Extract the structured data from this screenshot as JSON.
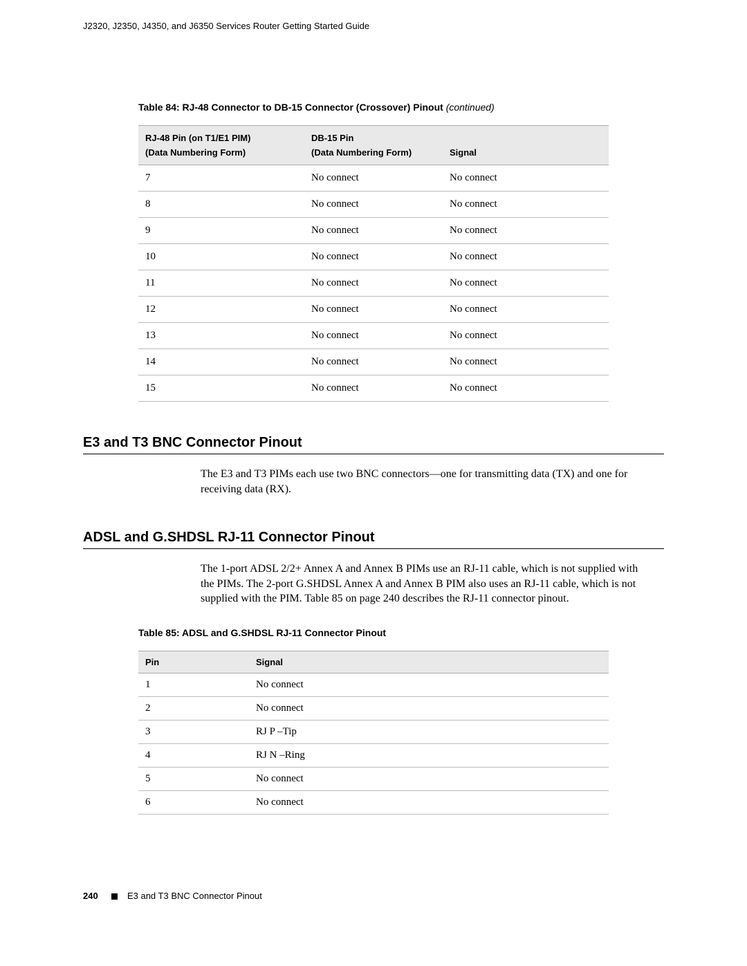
{
  "header": {
    "title": "J2320, J2350, J4350, and J6350 Services Router Getting Started Guide"
  },
  "table84": {
    "caption_main": "Table 84: RJ-48 Connector to DB-15 Connector (Crossover) Pinout",
    "caption_cont": " (continued)",
    "col1_line1": "RJ-48 Pin (on T1/E1 PIM)",
    "col1_line2": "(Data Numbering Form)",
    "col2_line1": "DB-15 Pin",
    "col2_line2": "(Data Numbering Form)",
    "col3": "Signal",
    "rows": [
      {
        "pin": "7",
        "db15": "No connect",
        "signal": "No connect"
      },
      {
        "pin": "8",
        "db15": "No connect",
        "signal": "No connect"
      },
      {
        "pin": "9",
        "db15": "No connect",
        "signal": "No connect"
      },
      {
        "pin": "10",
        "db15": "No connect",
        "signal": "No connect"
      },
      {
        "pin": "11",
        "db15": "No connect",
        "signal": "No connect"
      },
      {
        "pin": "12",
        "db15": "No connect",
        "signal": "No connect"
      },
      {
        "pin": "13",
        "db15": "No connect",
        "signal": "No connect"
      },
      {
        "pin": "14",
        "db15": "No connect",
        "signal": "No connect"
      },
      {
        "pin": "15",
        "db15": "No connect",
        "signal": "No connect"
      }
    ]
  },
  "section_e3t3": {
    "heading": "E3 and T3 BNC Connector Pinout",
    "body": "The E3 and T3 PIMs each use two BNC connectors—one for transmitting data (TX) and one for receiving data (RX)."
  },
  "section_adsl": {
    "heading": "ADSL and G.SHDSL RJ-11 Connector Pinout",
    "body": "The 1-port ADSL 2/2+ Annex A and Annex B PIMs use an RJ-11 cable, which is not supplied with the PIMs. The 2-port G.SHDSL Annex A and Annex B PIM also uses an RJ-11 cable, which is not supplied with the PIM. Table 85 on page 240 describes the RJ-11 connector pinout."
  },
  "table85": {
    "caption": "Table 85: ADSL and G.SHDSL RJ-11 Connector Pinout",
    "col1": "Pin",
    "col2": "Signal",
    "rows": [
      {
        "pin": "1",
        "signal": "No connect"
      },
      {
        "pin": "2",
        "signal": "No connect"
      },
      {
        "pin": "3",
        "signal": "RJ P –Tip"
      },
      {
        "pin": "4",
        "signal": "RJ N –Ring"
      },
      {
        "pin": "5",
        "signal": "No connect"
      },
      {
        "pin": "6",
        "signal": "No connect"
      }
    ]
  },
  "footer": {
    "page_number": "240",
    "section": "E3 and T3 BNC Connector Pinout"
  }
}
